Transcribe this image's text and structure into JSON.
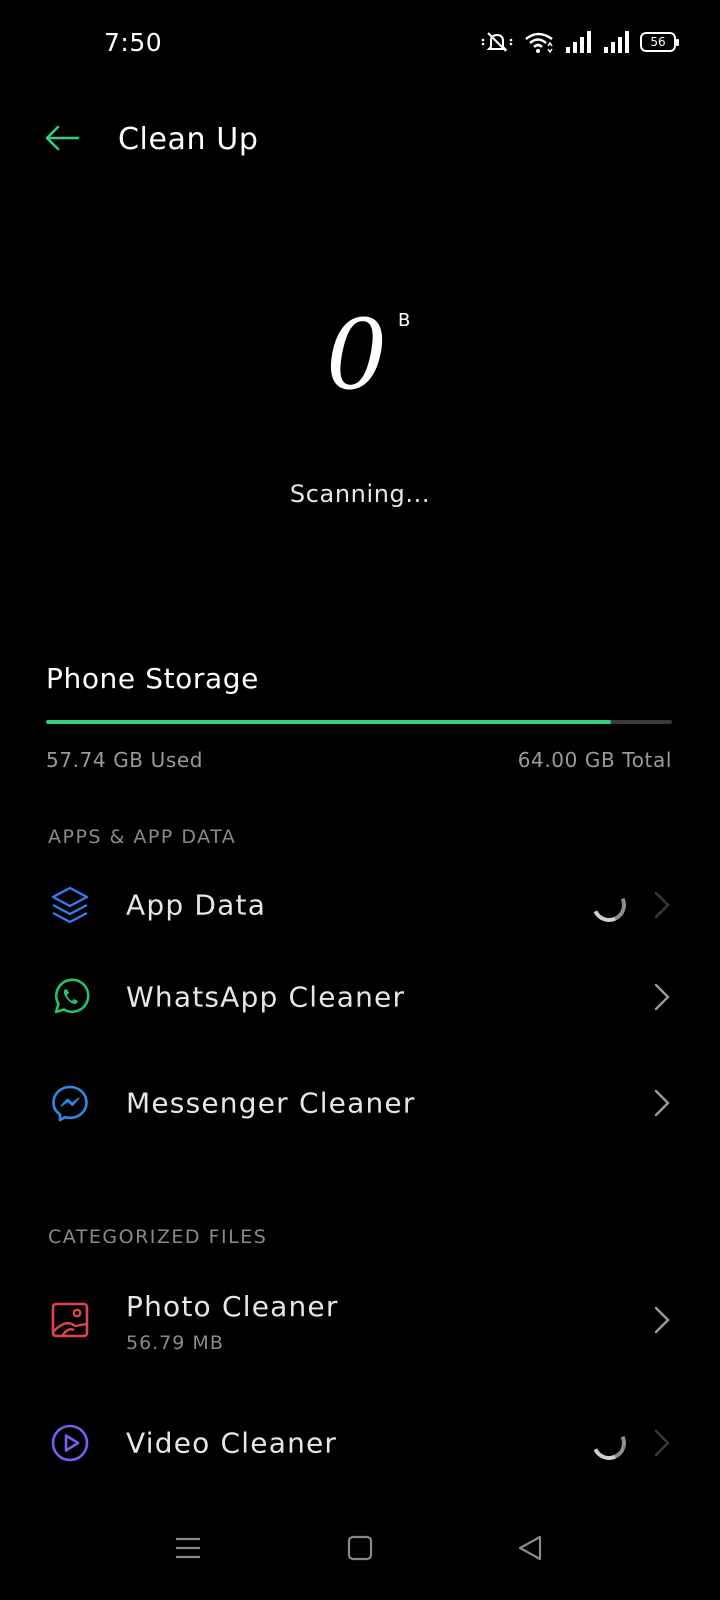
{
  "status_bar": {
    "time": "7:50",
    "battery": "56",
    "icons": [
      "mute-icon",
      "wifi-icon",
      "signal-icon",
      "signal-icon-2",
      "battery-icon"
    ]
  },
  "header": {
    "back_icon": "arrow-left-icon",
    "title": "Clean Up",
    "accent_color": "#2fd07f"
  },
  "scan": {
    "size_value": "0",
    "size_unit": "B",
    "status": "Scanning..."
  },
  "storage": {
    "title": "Phone Storage",
    "used_label": "57.74 GB Used",
    "total_label": "64.00 GB Total",
    "used_fraction": 0.902,
    "bar_color": "#2fd07f"
  },
  "sections": {
    "apps": {
      "header": "APPS & APP DATA",
      "items": [
        {
          "label": "App Data",
          "icon": "layers-icon",
          "icon_color": "#2f7ff0",
          "loading": true
        },
        {
          "label": "WhatsApp Cleaner",
          "icon": "whatsapp-icon",
          "icon_color": "#25c26a",
          "loading": false
        },
        {
          "label": "Messenger Cleaner",
          "icon": "messenger-icon",
          "icon_color": "#2e8ae6",
          "loading": false
        }
      ]
    },
    "files": {
      "header": "CATEGORIZED FILES",
      "items": [
        {
          "label": "Photo Cleaner",
          "sub": "56.79 MB",
          "icon": "photo-icon",
          "icon_color": "#e0444c",
          "loading": false
        },
        {
          "label": "Video Cleaner",
          "icon": "play-circle-icon",
          "icon_color": "#7a5cf0",
          "loading": true
        }
      ]
    }
  },
  "nav_bar": {
    "items": [
      "menu-icon",
      "home-square-icon",
      "back-triangle-icon"
    ]
  }
}
